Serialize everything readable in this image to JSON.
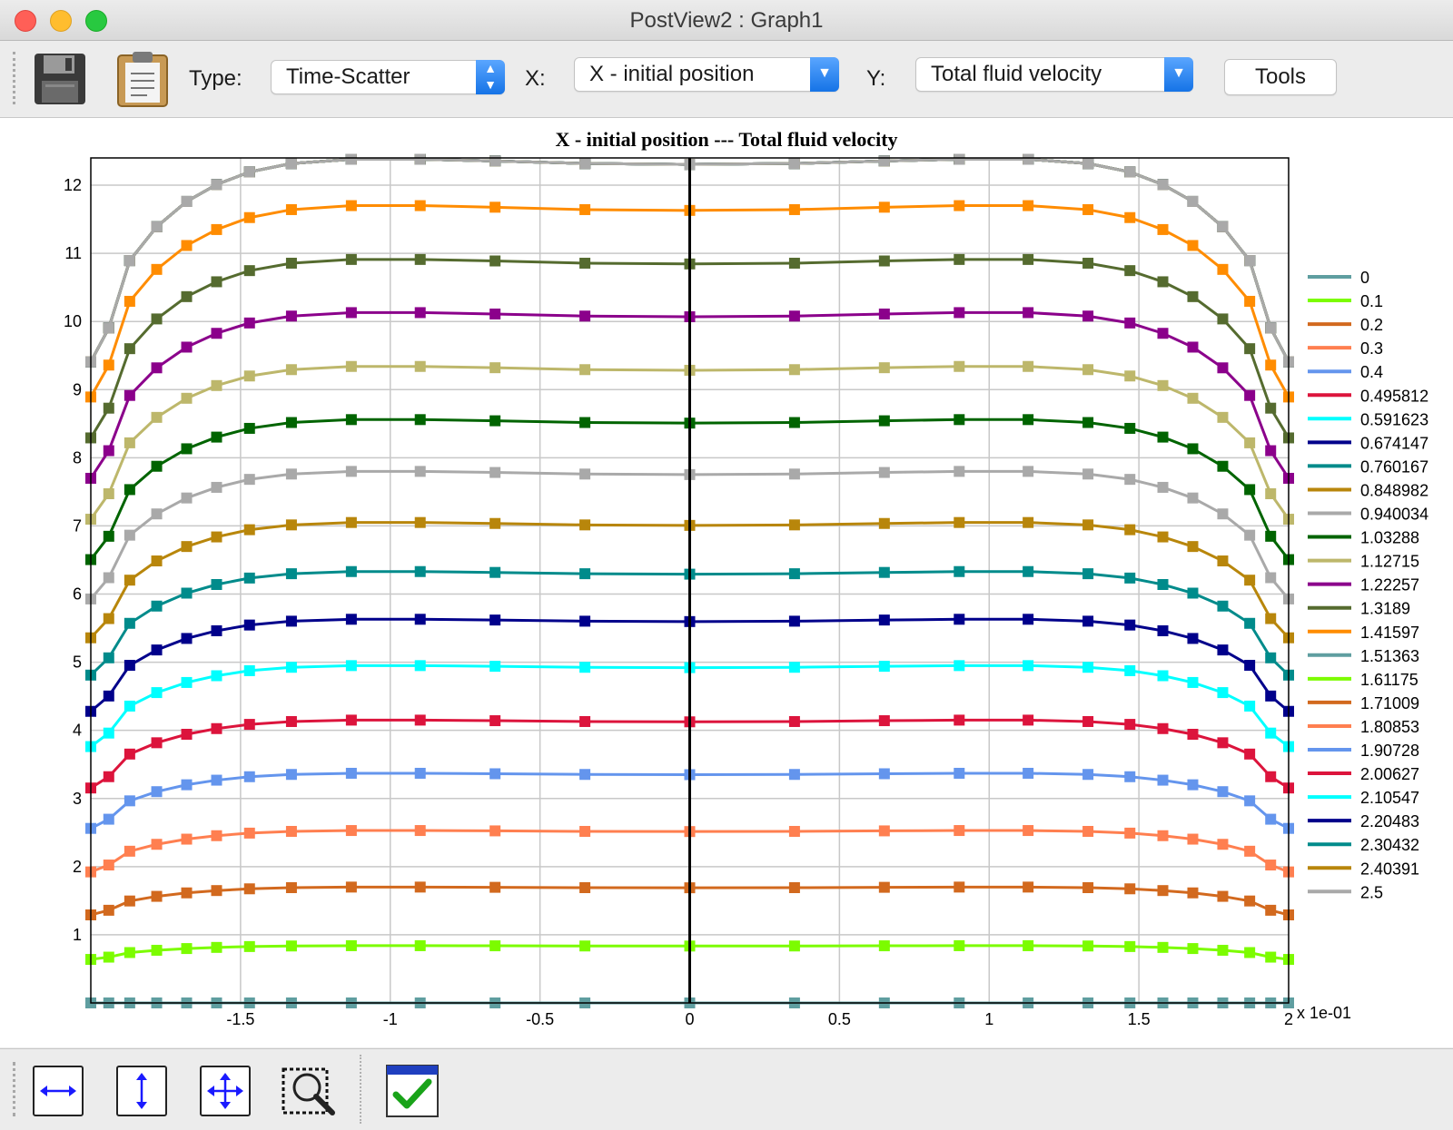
{
  "window": {
    "title": "PostView2 : Graph1"
  },
  "toolbar": {
    "save_tooltip": "save-icon",
    "clipboard_tooltip": "clipboard-icon",
    "type_label": "Type:",
    "type_value": "Time-Scatter",
    "x_label": "X:",
    "x_value": "X - initial position",
    "y_label": "Y:",
    "y_value": "Total fluid velocity",
    "tools_label": "Tools"
  },
  "bottom_toolbar": {
    "icons": [
      "zoom-width-icon",
      "zoom-height-icon",
      "zoom-fit-icon",
      "zoom-region-icon",
      "toggle-check-icon"
    ]
  },
  "chart_data": {
    "type": "line",
    "title": "X - initial position --- Total fluid velocity",
    "xlabel": "",
    "ylabel": "",
    "x_multiplier_label": "x 1e-01",
    "xlim": [
      -2,
      2
    ],
    "ylim": [
      0,
      12.4
    ],
    "x_ticks": [
      "-1.5",
      "-1",
      "-0.5",
      "0",
      "0.5",
      "1",
      "1.5",
      "2"
    ],
    "y_ticks": [
      "1",
      "2",
      "3",
      "4",
      "5",
      "6",
      "7",
      "8",
      "9",
      "10",
      "11",
      "12"
    ],
    "grid": true,
    "legend_position": "right",
    "x": [
      -2.0,
      -1.94,
      -1.87,
      -1.78,
      -1.68,
      -1.58,
      -1.47,
      -1.33,
      -1.13,
      -0.9,
      -0.65,
      -0.35,
      0.0,
      0.35,
      0.65,
      0.9,
      1.13,
      1.33,
      1.47,
      1.58,
      1.68,
      1.78,
      1.87,
      1.94,
      2.0
    ],
    "series": [
      {
        "name": "0",
        "color": "#5f9ea0",
        "peak": 0.0
      },
      {
        "name": "0.1",
        "color": "#7cfc00",
        "peak": 0.84
      },
      {
        "name": "0.2",
        "color": "#d2691e",
        "peak": 1.7
      },
      {
        "name": "0.3",
        "color": "#ff7f50",
        "peak": 2.53
      },
      {
        "name": "0.4",
        "color": "#6495ed",
        "peak": 3.37
      },
      {
        "name": "0.495812",
        "color": "#dc143c",
        "peak": 4.15
      },
      {
        "name": "0.591623",
        "color": "#00ffff",
        "peak": 4.95
      },
      {
        "name": "0.674147",
        "color": "#00008b",
        "peak": 5.63
      },
      {
        "name": "0.760167",
        "color": "#008b8b",
        "peak": 6.33
      },
      {
        "name": "0.848982",
        "color": "#b8860b",
        "peak": 7.05
      },
      {
        "name": "0.940034",
        "color": "#a9a9a9",
        "peak": 7.8
      },
      {
        "name": "1.03288",
        "color": "#006400",
        "peak": 8.56
      },
      {
        "name": "1.12715",
        "color": "#bdb76b",
        "peak": 9.34
      },
      {
        "name": "1.22257",
        "color": "#8b008b",
        "peak": 10.13
      },
      {
        "name": "1.3189",
        "color": "#556b2f",
        "peak": 10.91
      },
      {
        "name": "1.41597",
        "color": "#ff8c00",
        "peak": 11.7
      },
      {
        "name": "1.51363",
        "color": "#5f9ea0",
        "peak": 12.38
      },
      {
        "name": "1.61175",
        "color": "#7cfc00",
        "peak": 12.38
      },
      {
        "name": "1.71009",
        "color": "#d2691e",
        "peak": 12.38
      },
      {
        "name": "1.80853",
        "color": "#ff7f50",
        "peak": 12.38
      },
      {
        "name": "1.90728",
        "color": "#6495ed",
        "peak": 12.38
      },
      {
        "name": "2.00627",
        "color": "#dc143c",
        "peak": 12.38
      },
      {
        "name": "2.10547",
        "color": "#00ffff",
        "peak": 12.38
      },
      {
        "name": "2.20483",
        "color": "#00008b",
        "peak": 12.38
      },
      {
        "name": "2.30432",
        "color": "#008b8b",
        "peak": 12.38
      },
      {
        "name": "2.40391",
        "color": "#b8860b",
        "peak": 12.38
      },
      {
        "name": "2.5",
        "color": "#a9a9a9",
        "peak": 12.38
      }
    ],
    "profile_factors": [
      0.76,
      0.8,
      0.88,
      0.92,
      0.95,
      0.97,
      0.985,
      0.995,
      1.0,
      1.0,
      0.998,
      0.995,
      0.994,
      0.995,
      0.998,
      1.0,
      1.0,
      0.995,
      0.985,
      0.97,
      0.95,
      0.92,
      0.88,
      0.8,
      0.76
    ]
  }
}
